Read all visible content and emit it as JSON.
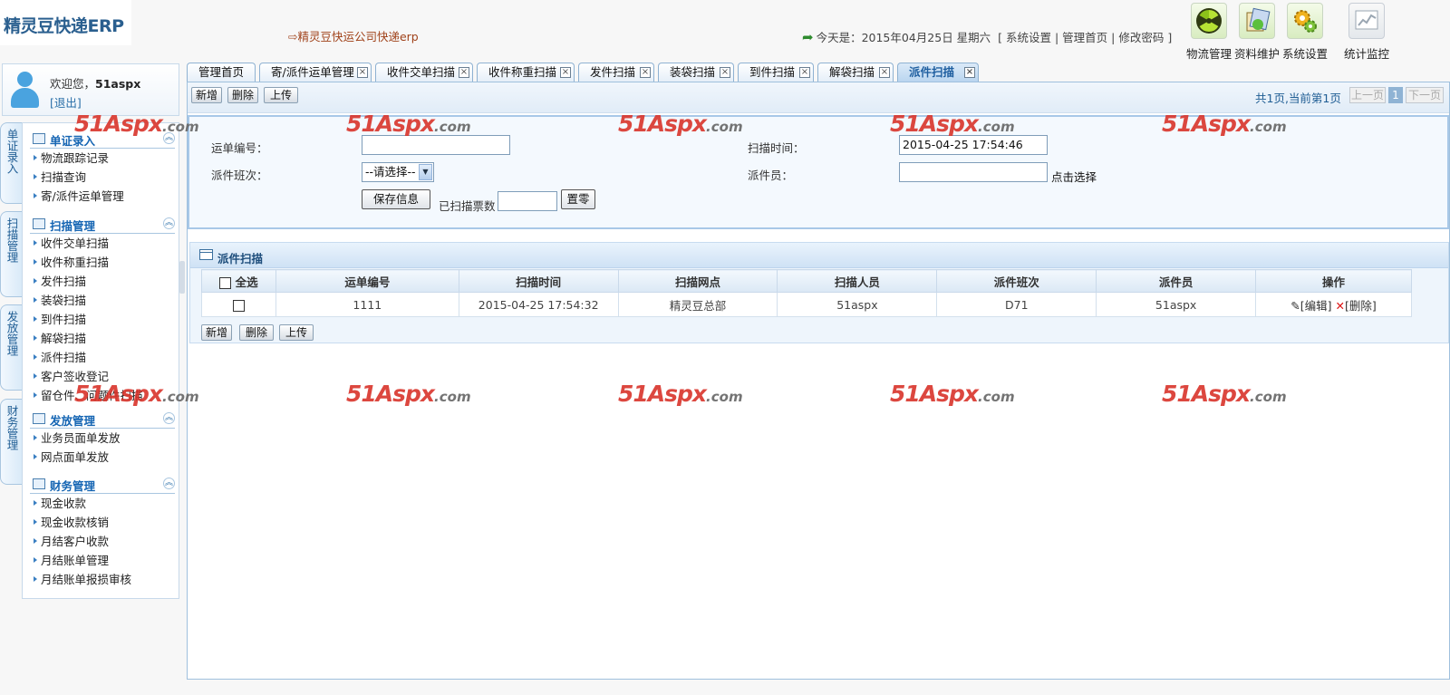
{
  "header": {
    "app_title": "精灵豆快递ERP",
    "company": "⇨精灵豆快运公司快递erp",
    "date_text": "今天是：2015年04月25日 星期六",
    "links": [
      "系统设置",
      "管理首页",
      "修改密码"
    ],
    "top_icons": [
      {
        "label": "物流管理",
        "icon": "radiation-icon"
      },
      {
        "label": "资料维护",
        "icon": "documents-icon"
      },
      {
        "label": "系统设置",
        "icon": "gears-icon"
      },
      {
        "label": "统计监控",
        "icon": "chart-icon"
      }
    ]
  },
  "user": {
    "welcome": "欢迎您，",
    "name": "51aspx",
    "logout": "[退出]"
  },
  "vertical_tabs": [
    "单证录入",
    "扫描管理",
    "发放管理",
    "财务管理"
  ],
  "menu": [
    {
      "title": "单证录入",
      "items": [
        "物流跟踪记录",
        "扫描查询",
        "寄/派件运单管理"
      ]
    },
    {
      "title": "扫描管理",
      "items": [
        "收件交单扫描",
        "收件称重扫描",
        "发件扫描",
        "装袋扫描",
        "到件扫描",
        "解袋扫描",
        "派件扫描",
        "客户签收登记",
        "留仓件、问题件扫描"
      ]
    },
    {
      "title": "发放管理",
      "items": [
        "业务员面单发放",
        "网点面单发放"
      ]
    },
    {
      "title": "财务管理",
      "items": [
        "现金收款",
        "现金收款核销",
        "月结客户收款",
        "月结账单管理",
        "月结账单报损审核"
      ]
    }
  ],
  "tabs": [
    "管理首页",
    "寄/派件运单管理",
    "收件交单扫描",
    "收件称重扫描",
    "发件扫描",
    "装袋扫描",
    "到件扫描",
    "解袋扫描",
    "派件扫描"
  ],
  "active_tab": "派件扫描",
  "toolbar": {
    "add": "新增",
    "delete": "删除",
    "upload": "上传"
  },
  "pager": {
    "info": "共1页,当前第1页",
    "prev": "上一页",
    "current": "1",
    "next": "下一页"
  },
  "form": {
    "waybill_label": "运单编号：",
    "waybill_value": "",
    "scan_time_label": "扫描时间：",
    "scan_time_value": "2015-04-25 17:54:46",
    "shift_label": "派件班次：",
    "shift_value": "--请选择--",
    "courier_label": "派件员：",
    "courier_value": "",
    "pick_link": "点击选择",
    "save_button": "保存信息",
    "scanned_label": "已扫描票数",
    "scanned_value": "",
    "reset_button": "置零"
  },
  "grid": {
    "title": "派件扫描",
    "select_all": "全选",
    "columns": [
      "运单编号",
      "扫描时间",
      "扫描网点",
      "扫描人员",
      "派件班次",
      "派件员",
      "操作"
    ],
    "rows": [
      {
        "waybill": "1111",
        "scan_time": "2015-04-25 17:54:32",
        "site": "精灵豆总部",
        "scanner": "51aspx",
        "shift": "D71",
        "courier": "51aspx",
        "edit": "[编辑]",
        "delete": "[删除]"
      }
    ]
  },
  "watermark": {
    "brand": "51Aspx",
    "suffix": ".com"
  },
  "colors": {
    "accent": "#1565b3",
    "watermark": "#d9342b",
    "border": "#9fc0dd"
  }
}
